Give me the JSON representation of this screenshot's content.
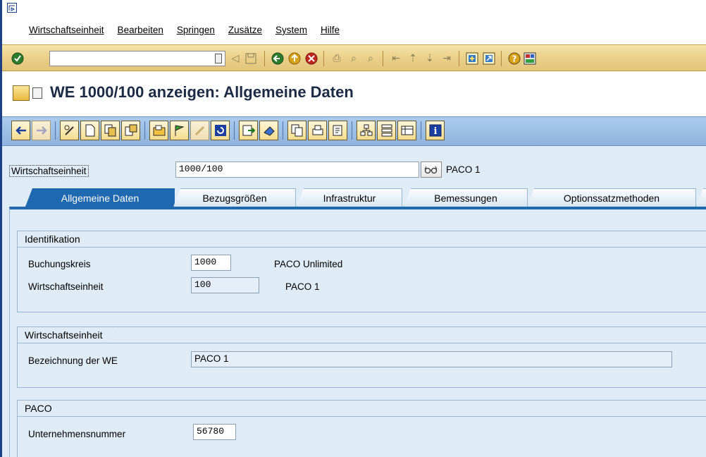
{
  "menu": {
    "items": [
      "Wirtschaftseinheit",
      "Bearbeiten",
      "Springen",
      "Zusätze",
      "System",
      "Hilfe"
    ]
  },
  "toolbar": {
    "command_value": "",
    "icons": [
      "enter-icon",
      "save-icon",
      "back-icon",
      "exit-icon",
      "cancel-icon",
      "print-icon",
      "find-icon",
      "find-next-icon",
      "first-page-icon",
      "prev-page-icon",
      "next-page-icon",
      "last-page-icon",
      "new-session-icon",
      "shortcut-icon",
      "help-icon",
      "layout-icon"
    ]
  },
  "title": {
    "text": "WE 1000/100 anzeigen: Allgemeine Daten"
  },
  "header": {
    "we_label": "Wirtschaftseinheit",
    "we_value": "1000/100",
    "we_description": "PACO 1"
  },
  "tabs": [
    {
      "label": "Allgemeine Daten",
      "active": true
    },
    {
      "label": "Bezugsgrößen",
      "active": false
    },
    {
      "label": "Infrastruktur",
      "active": false
    },
    {
      "label": "Bemessungen",
      "active": false
    },
    {
      "label": "Optionssatzmethoden",
      "active": false
    }
  ],
  "groups": {
    "identifikation": {
      "title": "Identifikation",
      "buchungskreis_label": "Buchungskreis",
      "buchungskreis_value": "1000",
      "buchungskreis_text": "PACO Unlimited",
      "we_label": "Wirtschaftseinheit",
      "we_value": "100",
      "we_text": "PACO 1"
    },
    "wirtschaftseinheit": {
      "title": "Wirtschaftseinheit",
      "bezeichnung_label": "Bezeichnung der WE",
      "bezeichnung_value": "PACO 1"
    },
    "paco": {
      "title": "PACO",
      "unternehmensnummer_label": "Unternehmensnummer",
      "unternehmensnummer_value": "56780"
    }
  },
  "colors": {
    "accent": "#1f69b0",
    "toolbar": "#ead08a",
    "app_toolbar": "#9bbde6",
    "background": "#dfebf5"
  }
}
